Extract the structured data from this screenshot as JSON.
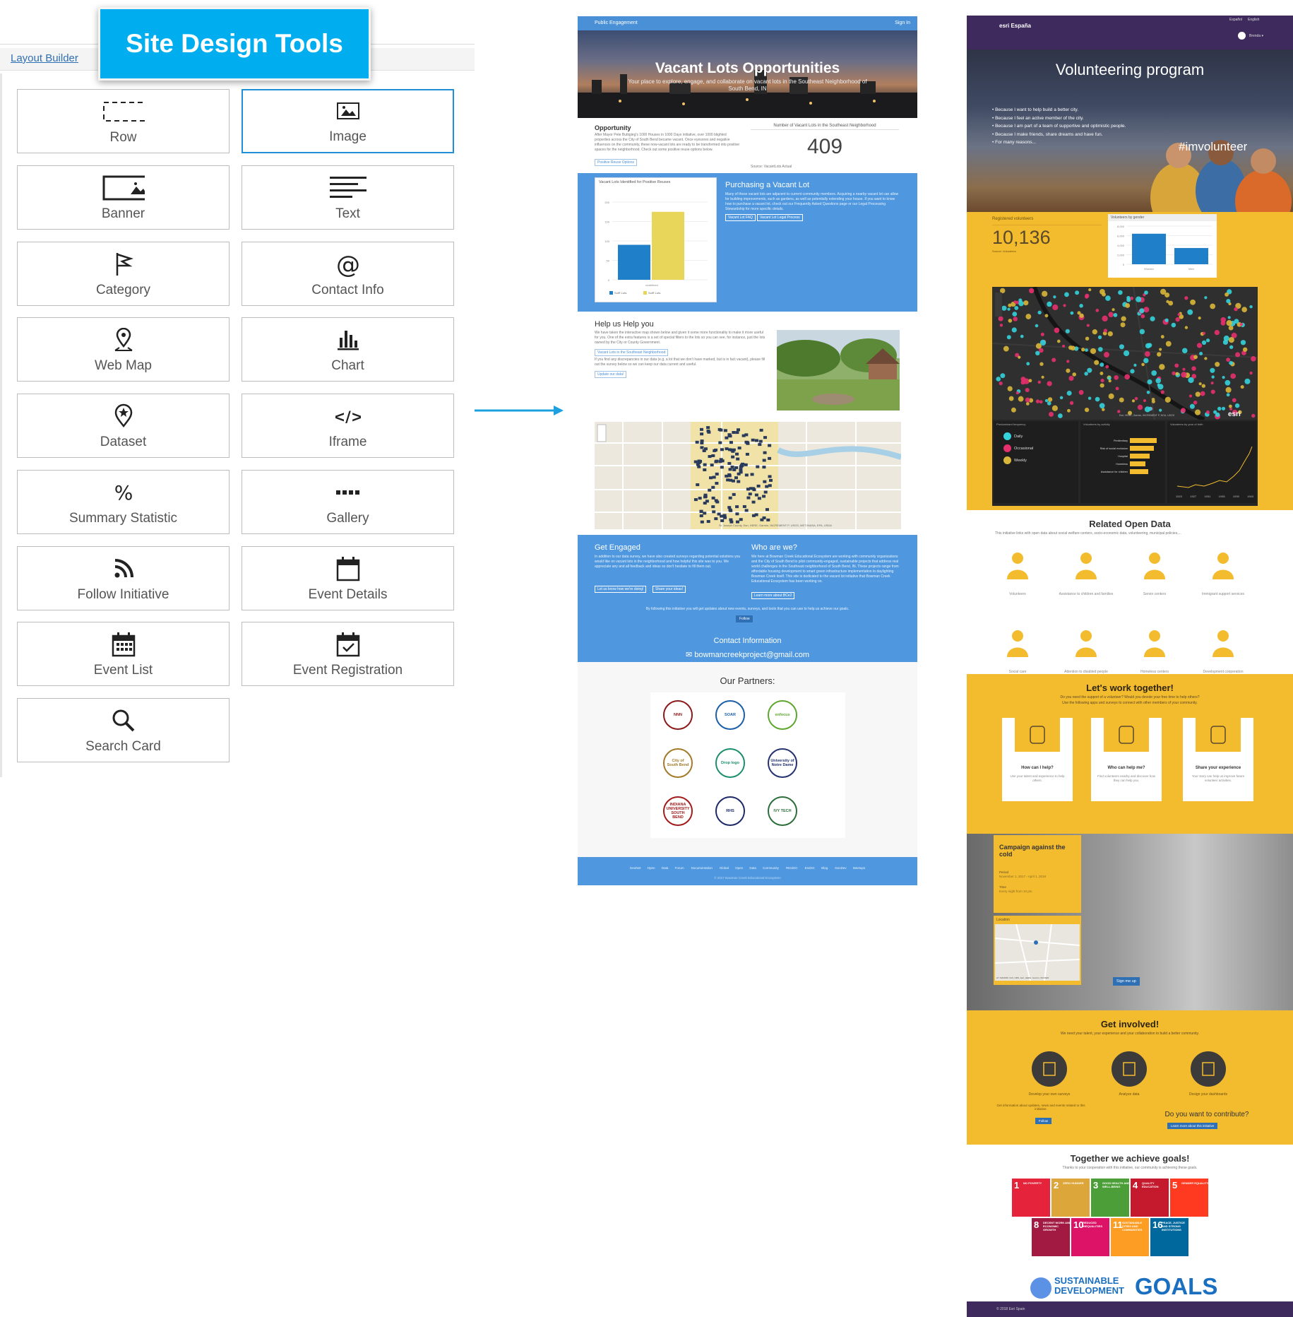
{
  "badge": {
    "title": "Site Design Tools"
  },
  "layout_builder": {
    "tab_label": "Layout Builder",
    "tools": [
      {
        "label": "Row",
        "icon": "row-icon"
      },
      {
        "label": "Image",
        "icon": "image-icon",
        "selected": true
      },
      {
        "label": "Banner",
        "icon": "banner-icon"
      },
      {
        "label": "Text",
        "icon": "text-icon"
      },
      {
        "label": "Category",
        "icon": "flag-icon"
      },
      {
        "label": "Contact Info",
        "icon": "at-icon"
      },
      {
        "label": "Web Map",
        "icon": "map-pin-icon"
      },
      {
        "label": "Chart",
        "icon": "chart-icon"
      },
      {
        "label": "Dataset",
        "icon": "dataset-icon"
      },
      {
        "label": "Iframe",
        "icon": "code-icon"
      },
      {
        "label": "Summary Statistic",
        "icon": "percent-icon"
      },
      {
        "label": "Gallery",
        "icon": "gallery-icon"
      },
      {
        "label": "Follow Initiative",
        "icon": "rss-icon"
      },
      {
        "label": "Event Details",
        "icon": "calendar-icon"
      },
      {
        "label": "Event List",
        "icon": "calendar-grid-icon"
      },
      {
        "label": "Event Registration",
        "icon": "calendar-check-icon"
      },
      {
        "label": "Search Card",
        "icon": "search-icon"
      }
    ]
  },
  "vacant": {
    "topbar": {
      "left": "Public Engagement",
      "right": "Sign In"
    },
    "hero": {
      "title": "Vacant Lots Opportunities",
      "subtitle": "Your place to explore, engage, and collaborate on vacant lots in the Southeast Neighborhood of South Bend, IN"
    },
    "opportunity": {
      "title": "Opportunity",
      "body": "After Mayor Pete Buttigieg's 1000 Houses in 1000 Days initiative, over 1000 blighted properties across the City of South Bend became vacant. Once eyesores and negative influences on the community, these now-vacant lots are ready to be transformed into positive spaces for the neighborhood. Check out some positive reuse options below.",
      "button": "Positive Reuse Options"
    },
    "stat": {
      "label": "Number of Vacant Lots in the Southeast Neighborhood",
      "value": "409",
      "source": "Source: VacantLots Actual"
    },
    "chart_card": {
      "title": "Vacant Lots Identified for Positive Reuses",
      "legend": [
        "SolR Lots",
        "SolR Lots"
      ]
    },
    "purchasing": {
      "title": "Purchasing a Vacant Lot",
      "body": "Many of these vacant lots are adjacent to current community members. Acquiring a nearby vacant lot can allow for building improvements, such as gardens, as well as potentially extending your house. If you want to know how to purchase a vacant lot, check out our Frequently Asked Questions page or our Legal Processing Stewardship for more specific details.",
      "buttons": [
        "Vacant Lot FAQ",
        "Vacant Lot Legal Process"
      ]
    },
    "help": {
      "title": "Help us Help you",
      "body1": "We have taken the interactive map shown below and given it some more functionality to make it more useful for you. One of the extra features is a set of special filters to the lots so you can see, for instance, just the lots owned by the City or County Government.",
      "button1": "Vacant Lots in the Southeast Neighborhood",
      "body2": "If you find any discrepancies in our data (e.g. a lot that we don't have marked, but is in fact vacant), please fill out the survey below so we can keep our data current and useful.",
      "button2": "Update our data!"
    },
    "map_credit": "St. Joseph County, Esri, HERE, Garmin, INCREMENT P, USGS, METI/NASA, EPA, USDA",
    "engaged": {
      "title": "Get Engaged",
      "body": "In addition to our data survey, we have also created surveys regarding potential solutions you would like on vacant lots in the neighborhood and how helpful this site was to you. We appreciate any and all feedback and ideas so don't hesitate to fill them out.",
      "buttons": [
        "Let us know how we're doing!",
        "Share your ideas!"
      ]
    },
    "who": {
      "title": "Who are we?",
      "body": "We here at Bowman Creek Educational Ecosystem are working with community organizations and the City of South Bend to pilot community-engaged, sustainable projects that address real world challenges in the Southeast neighborhood of South Bend, IN. These projects range from affordable housing development to smart green infrastructure implementation to daylighting Bowman Creek itself. This site is dedicated to the vacant lot initiative that Bowman Creek Educational Ecosystem has been working on.",
      "button": "Learn more about BCe2"
    },
    "follow_text": "By following this initiative you will get updates about new events, surveys, and tools that you can use to help us achieve our goals.",
    "follow_button": "Follow",
    "contact": {
      "title": "Contact Information",
      "email": "bowmancreekproject@gmail.com"
    },
    "partners": {
      "title": "Our Partners:",
      "logos": [
        "NNN",
        "SOAR",
        "enfocus",
        "City of South Bend",
        "Drop logo",
        "University of Notre Dame",
        "INDIANA UNIVERSITY SOUTH BEND",
        "RHS",
        "IVY TECH"
      ]
    },
    "footer": {
      "links": [
        "GeoNet Open Data Forum",
        "Documentation",
        "Global Open Data Community",
        "#EsriDC",
        "EsriDC Blog",
        "GeoDev Meetups"
      ],
      "copyright": "© 2017 Bowman Creek Educational Ecosystem"
    }
  },
  "chart_data": {
    "type": "bar",
    "title": "Vacant Lots Identified for Positive Reuses",
    "categories": [
      "undefined"
    ],
    "series": [
      {
        "name": "SolR Lots",
        "values": [
          90
        ],
        "color": "#1f7fc8"
      },
      {
        "name": "SolR Lots",
        "values": [
          175
        ],
        "color": "#e7d65a"
      }
    ],
    "ylim": [
      0,
      200
    ],
    "yticks": [
      0,
      50,
      100,
      150,
      200
    ]
  },
  "volunteer": {
    "header": {
      "brand": "esri España",
      "lang_es": "Español",
      "lang_en": "English",
      "user": "Brenda ▾"
    },
    "hero": {
      "title": "Volunteering program",
      "bullets": [
        "Because I want to help build a better city.",
        "Because I feel an active member of the city.",
        "Because I am part of a team of supportive and optimistic people.",
        "Because I make friends, share dreams and have fun.",
        "For many reasons..."
      ],
      "hashtag": "#imvolunteer"
    },
    "registered": {
      "label": "Registered volunteers",
      "value": "10,136",
      "source": "Source: Volunteers"
    },
    "gender_chart": {
      "title": "Volunteers by gender",
      "categories": [
        "Women",
        "Men"
      ],
      "values": [
        6400,
        3400
      ],
      "yticks": [
        "8,000",
        "6,000",
        "4,000",
        "2,000",
        "0"
      ]
    },
    "dash": {
      "freq_title": "Predominant frequency",
      "freq": [
        {
          "label": "Daily",
          "color": "#35d3dc"
        },
        {
          "label": "Occasional",
          "color": "#e8306f"
        },
        {
          "label": "Weekly",
          "color": "#d9b73a"
        }
      ],
      "activity_title": "Volunteers by activity",
      "activity": [
        "Penitentiary",
        "Risk of social exclusion",
        "Hospital",
        "Homeless",
        "Assistance for children"
      ],
      "year_title": "Volunteers by year of birth",
      "year_ticks": [
        "1923",
        "1927",
        "1931",
        "1935",
        "1939",
        "1943"
      ],
      "map_credit": "Esri, HERE, Garmin, INCREMENT P, NGA, USGS"
    },
    "related": {
      "title": "Related Open Data",
      "subtitle": "This initiative links with open data about social welfare centers, socio-economic data, volunteering, municipal policies,...",
      "items": [
        "Volunteers",
        "Assistance to children and families",
        "Senior centers",
        "Immigrant support services",
        "Social care",
        "Attention to disabled people",
        "Homeless centers",
        "Development cooperation"
      ]
    },
    "together": {
      "title": "Let's work together!",
      "subtitle1": "Do you need the support of a volunteer? Would you devote your free time to help others?",
      "subtitle2": "Use the following apps and surveys to connect with other members of your community.",
      "cards": [
        {
          "title": "How can I help?",
          "desc": "Use your talent and experience to help others."
        },
        {
          "title": "Who can help me?",
          "desc": "Find volunteers nearby and discover how they can help you."
        },
        {
          "title": "Share your experience",
          "desc": "Your story can help us improve future volunteer activities."
        }
      ]
    },
    "campaign": {
      "title": "Campaign against the cold",
      "period_label": "Period",
      "period": "November 1, 2017 - April 1, 2018",
      "time_label": "Time",
      "time": "Every night from 10 pm",
      "location_label": "Location",
      "map_credit": "HY MADRID, IGN, OMS, Esri, HERE, Garmin, INCREM",
      "button": "Sign me up"
    },
    "involved": {
      "title": "Get involved!",
      "subtitle": "We need your talent, your experience and your collaboration to build a better community.",
      "items": [
        "Develop your own surveys",
        "Analyze data",
        "Design your dashboards"
      ],
      "info": "Get information about updates, news and events related to this initiative.",
      "follow": "Follow",
      "contribute": "Do you want to contribute?",
      "learn": "Learn more about this initiative"
    },
    "goals": {
      "title": "Together we achieve goals!",
      "subtitle": "Thanks to your cooperation with this initiative, our community is achieving these goals.",
      "tiles": [
        {
          "n": "1",
          "t": "NO POVERTY",
          "color": "#e5243b"
        },
        {
          "n": "2",
          "t": "ZERO HUNGER",
          "color": "#dda63a"
        },
        {
          "n": "3",
          "t": "GOOD HEALTH AND WELL-BEING",
          "color": "#4c9f38"
        },
        {
          "n": "4",
          "t": "QUALITY EDUCATION",
          "color": "#c5192d"
        },
        {
          "n": "5",
          "t": "GENDER EQUALITY",
          "color": "#ff3a21"
        },
        {
          "n": "8",
          "t": "DECENT WORK AND ECONOMIC GROWTH",
          "color": "#a21942"
        },
        {
          "n": "10",
          "t": "REDUCED INEQUALITIES",
          "color": "#dd1367"
        },
        {
          "n": "11",
          "t": "SUSTAINABLE CITIES AND COMMUNITIES",
          "color": "#fd9d24"
        },
        {
          "n": "16",
          "t": "PEACE, JUSTICE AND STRONG INSTITUTIONS",
          "color": "#00689d"
        }
      ],
      "sdg_text1": "SUSTAINABLE",
      "sdg_text2": "DEVELOPMENT",
      "sdg_goals": "GOALS"
    },
    "footer": "© 2018 Esri Spain"
  },
  "colors": {
    "accent": "#00aeef",
    "mid_blue": "#4f98df",
    "esri_purple": "#3e2a5c",
    "yellow": "#f3bb2e"
  }
}
